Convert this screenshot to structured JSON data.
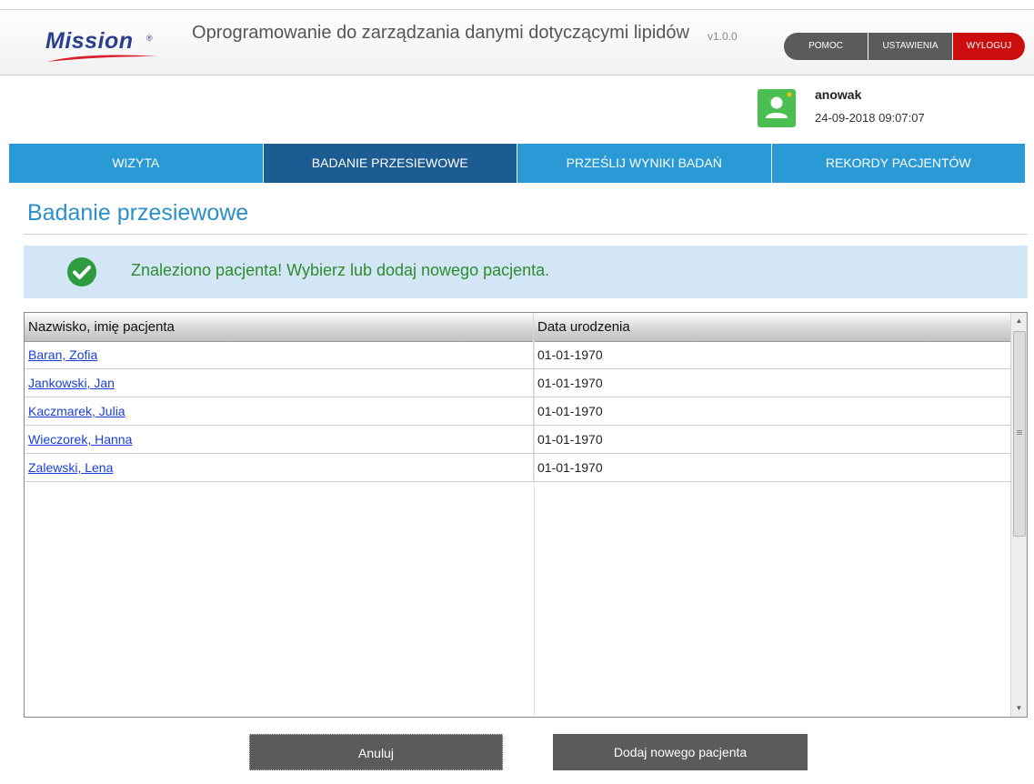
{
  "header": {
    "logo_text": "Mission",
    "logo_reg": "®",
    "app_title": "Oprogramowanie do zarządzania danymi dotyczącymi lipidów",
    "version": "v1.0.0",
    "buttons": {
      "help": "POMOC",
      "settings": "USTAWIENIA",
      "logout": "WYLOGUJ"
    }
  },
  "user": {
    "name": "anowak",
    "datetime": "24-09-2018 09:07:07"
  },
  "nav": {
    "tabs": [
      {
        "label": "WIZYTA"
      },
      {
        "label": "BADANIE PRZESIEWOWE"
      },
      {
        "label": "PRZEŚLIJ WYNIKI BADAŃ"
      },
      {
        "label": "REKORDY PACJENTÓW"
      }
    ],
    "active_index": 1
  },
  "page": {
    "title": "Badanie przesiewowe",
    "alert_text": "Znaleziono pacjenta! Wybierz lub dodaj nowego pacjenta."
  },
  "table": {
    "headers": {
      "name": "Nazwisko, imię pacjenta",
      "dob": "Data urodzenia"
    },
    "rows": [
      {
        "name": "Baran, Zofia",
        "dob": "01-01-1970"
      },
      {
        "name": "Jankowski, Jan",
        "dob": "01-01-1970"
      },
      {
        "name": "Kaczmarek, Julia",
        "dob": "01-01-1970"
      },
      {
        "name": "Wieczorek, Hanna",
        "dob": "01-01-1970"
      },
      {
        "name": "Zalewski, Lena",
        "dob": "01-01-1970"
      }
    ]
  },
  "actions": {
    "cancel": "Anuluj",
    "add_patient": "Dodaj nowego pacjenta"
  },
  "colors": {
    "nav_blue": "#2a9ad6",
    "nav_active": "#1d5c93",
    "title_blue": "#2b8fc8",
    "alert_bg": "#d2e6f5",
    "success_green": "#2e8b2e",
    "logout_red": "#cc0d0d",
    "button_gray": "#5b5b5b"
  },
  "icons": {
    "avatar": "user-avatar-icon",
    "success": "check-circle-icon"
  }
}
